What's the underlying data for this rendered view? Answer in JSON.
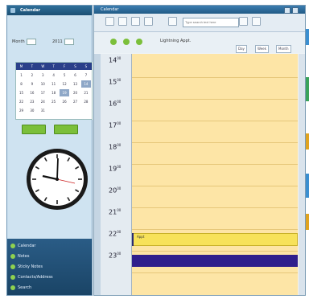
{
  "left_panel": {
    "title": "Calendar",
    "selectors": {
      "month": "Month",
      "year": "2011"
    },
    "weekdays": [
      "M",
      "T",
      "W",
      "T",
      "F",
      "S",
      "S"
    ],
    "days": [
      [
        "1",
        "2",
        "3",
        "4",
        "5",
        "6",
        "7"
      ],
      [
        "8",
        "9",
        "10",
        "11",
        "12",
        "13",
        "14"
      ],
      [
        "15",
        "16",
        "17",
        "18",
        "19",
        "20",
        "21"
      ],
      [
        "22",
        "23",
        "24",
        "25",
        "26",
        "27",
        "28"
      ],
      [
        "29",
        "30",
        "31",
        "",
        "",
        "",
        ""
      ]
    ],
    "tasks": [
      "Calendar",
      "Notes",
      "Sticky Notes",
      "Contacts/Address",
      "Search"
    ]
  },
  "window": {
    "title": "Calendar",
    "search_placeholder": "Type search text here",
    "toolbar_label": "Lightning Appt.",
    "tabs": [
      "Day",
      "Week",
      "Month"
    ],
    "hours": [
      {
        "h": "14",
        "m": "00"
      },
      {
        "h": "15",
        "m": "00"
      },
      {
        "h": "16",
        "m": "00"
      },
      {
        "h": "17",
        "m": "00"
      },
      {
        "h": "18",
        "m": "00"
      },
      {
        "h": "19",
        "m": "00"
      },
      {
        "h": "20",
        "m": "00"
      },
      {
        "h": "21",
        "m": "00"
      },
      {
        "h": "22",
        "m": "00"
      },
      {
        "h": "23",
        "m": "00"
      }
    ],
    "event_label": "Appt"
  },
  "colors": {
    "accent": "#215a86",
    "slot": "#fde5a6",
    "event_yellow": "#f7e25a",
    "event_purple": "#2f1f8c"
  }
}
